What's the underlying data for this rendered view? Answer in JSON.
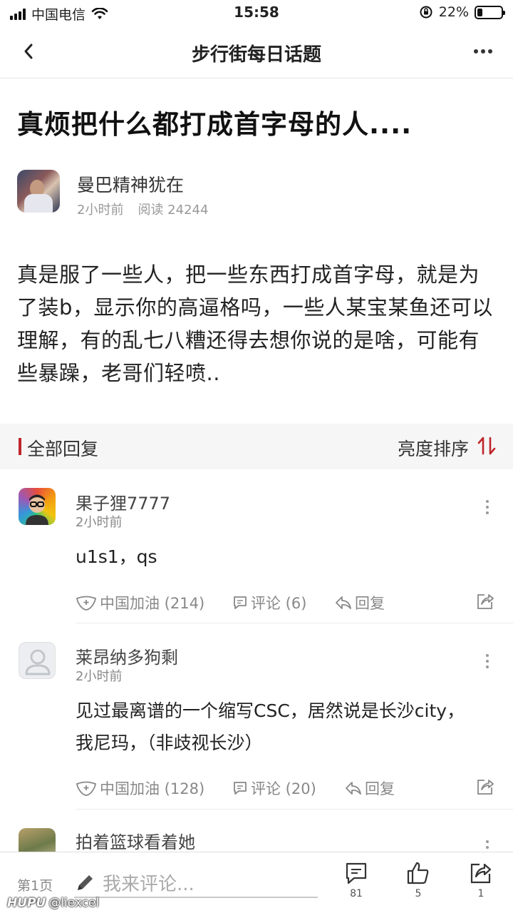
{
  "status_bar": {
    "carrier": "中国电信",
    "time": "15:58",
    "battery_text": "22%",
    "battery_level": 0.22
  },
  "nav": {
    "title": "步行街每日话题"
  },
  "post": {
    "title": "真烦把什么都打成首字母的人....",
    "author": "曼巴精神犹在",
    "time": "2小时前",
    "reads": "阅读 24244",
    "body": "真是服了一些人，把一些东西打成首字母，就是为了装b，显示你的高逼格吗，一些人某宝某鱼还可以理解，有的乱七八糟还得去想你说的是啥，可能有些暴躁，老哥们轻喷.."
  },
  "replies_header": {
    "title": "全部回复",
    "sort": "亮度排序",
    "accent": "#c0262d"
  },
  "comments": [
    {
      "name": "果子狸7777",
      "time": "2小时前",
      "text": "u1s1，qs",
      "cheer": "中国加油 (214)",
      "comment": "评论 (6)",
      "reply": "回复"
    },
    {
      "name": "莱昂纳多狗剩",
      "time": "2小时前",
      "text": "见过最离谱的一个缩写CSC，居然说是长沙city，我尼玛，（非歧视长沙）",
      "cheer": "中国加油 (128)",
      "comment": "评论 (20)",
      "reply": "回复"
    },
    {
      "name": "拍着篮球看着她"
    }
  ],
  "bottom_bar": {
    "page": "第1页",
    "placeholder": "我来评论...",
    "comments_count": "81",
    "likes_count": "5",
    "shares_count": "1"
  },
  "watermark": {
    "brand": "HUPU",
    "handle": "@liexcel"
  }
}
